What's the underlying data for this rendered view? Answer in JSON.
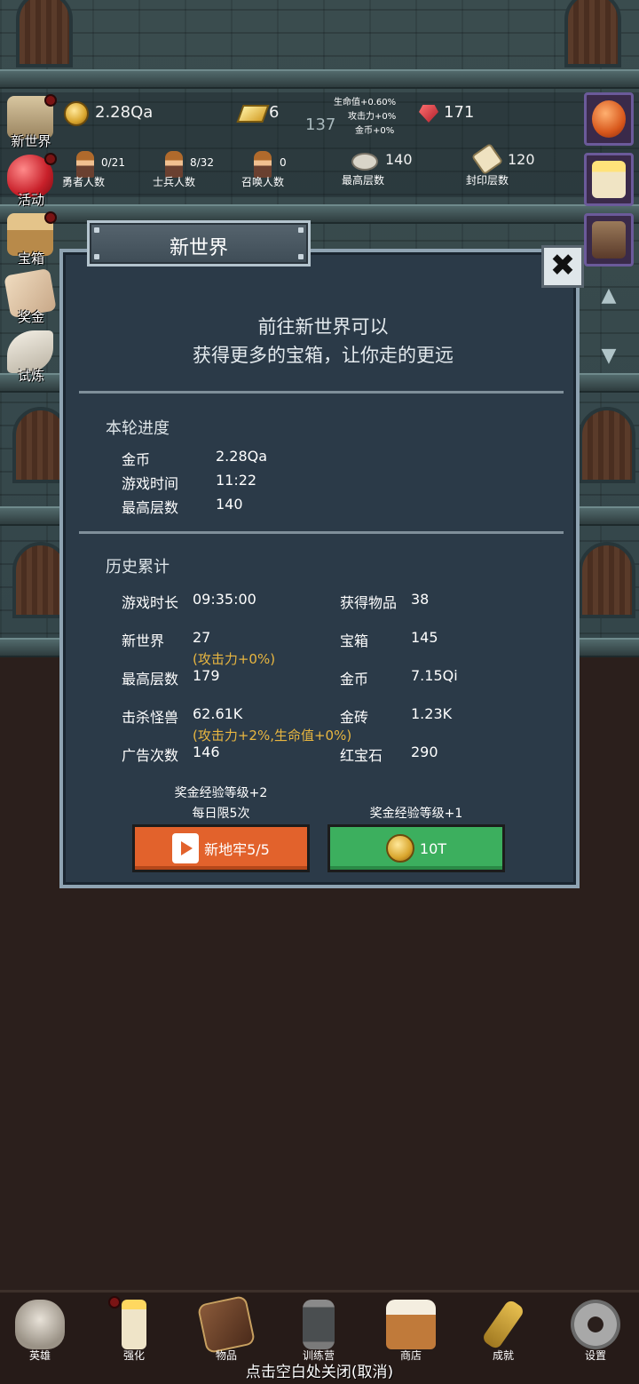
{
  "hud": {
    "gold": "2.28Qa",
    "gold_bars": "6",
    "floor_marker": "137",
    "bonus_hp": "生命值+0.60%",
    "bonus_atk": "攻击力+0%",
    "bonus_gold": "金币+0%",
    "rubies": "171",
    "heroes": {
      "value": "0/21",
      "label": "勇者人数"
    },
    "soldiers": {
      "value": "8/32",
      "label": "士兵人数"
    },
    "summons": {
      "value": "0",
      "label": "召唤人数"
    },
    "max_floor": {
      "value": "140",
      "label": "最高层数"
    },
    "sealed_floor": {
      "value": "120",
      "label": "封印层数"
    }
  },
  "side_menu": [
    {
      "label": "新世界"
    },
    {
      "label": "活动"
    },
    {
      "label": "宝箱"
    },
    {
      "label": "奖金"
    },
    {
      "label": "试炼"
    }
  ],
  "modal": {
    "title": "新世界",
    "close_glyph": "✖",
    "desc_line1": "前往新世界可以",
    "desc_line2": "获得更多的宝箱，让你走的更远",
    "current": {
      "heading": "本轮进度",
      "rows": [
        {
          "label": "金币",
          "value": "2.28Qa"
        },
        {
          "label": "游戏时间",
          "value": "11:22"
        },
        {
          "label": "最高层数",
          "value": "140"
        }
      ]
    },
    "history": {
      "heading": "历史累计",
      "play_time": {
        "label": "游戏时长",
        "value": "09:35:00"
      },
      "items": {
        "label": "获得物品",
        "value": "38"
      },
      "new_world": {
        "label": "新世界",
        "value": "27",
        "bonus": "(攻击力+0%)"
      },
      "chests": {
        "label": "宝箱",
        "value": "145"
      },
      "max_floor": {
        "label": "最高层数",
        "value": "179"
      },
      "gold": {
        "label": "金币",
        "value": "7.15Qi"
      },
      "kills": {
        "label": "击杀怪兽",
        "value": "62.61K",
        "bonus": "(攻击力+2%,生命值+0%)"
      },
      "gold_bricks": {
        "label": "金砖",
        "value": "1.23K"
      },
      "ads": {
        "label": "广告次数",
        "value": "146"
      },
      "rubies": {
        "label": "红宝石",
        "value": "290"
      }
    },
    "left_caption1": "奖金经验等级+2",
    "left_caption2": "每日限5次",
    "right_caption": "奖金经验等级+1",
    "left_button": "新地牢5/5",
    "right_button": "10T"
  },
  "bottom_nav": [
    {
      "label": "英雄"
    },
    {
      "label": "强化"
    },
    {
      "label": "物品"
    },
    {
      "label": "训练营"
    },
    {
      "label": "商店"
    },
    {
      "label": "成就"
    },
    {
      "label": "设置"
    }
  ],
  "close_hint": "点击空白处关闭(取消)"
}
